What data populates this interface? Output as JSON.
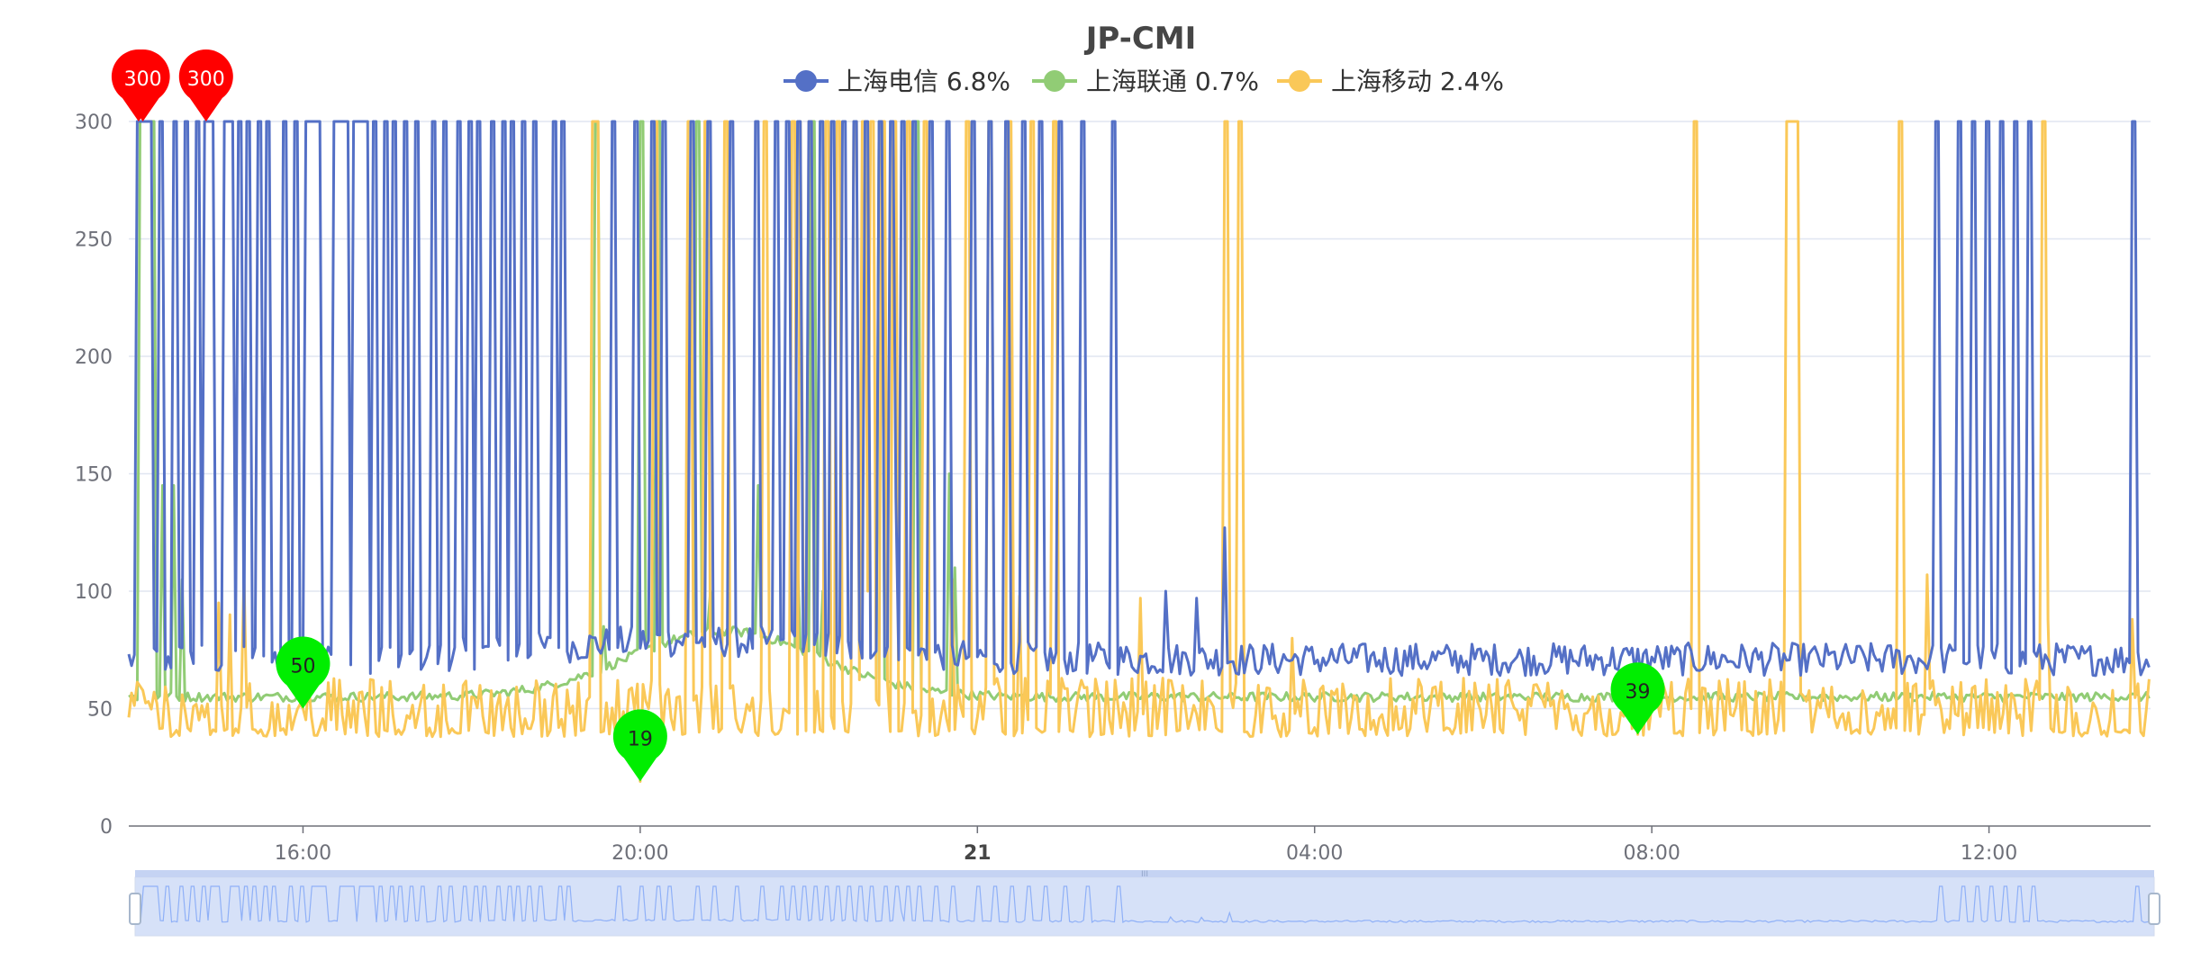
{
  "chart_data": {
    "type": "line",
    "title": "JP-CMI",
    "xlabel": "",
    "ylabel": "",
    "ylim": [
      0,
      300
    ],
    "y_ticks": [
      "0",
      "50",
      "100",
      "150",
      "200",
      "250",
      "300"
    ],
    "x_range": [
      "19 13:56",
      "20 13:55"
    ],
    "x_ticks": [
      {
        "label": "16:00",
        "t": "19 16:00",
        "bold": false
      },
      {
        "label": "20:00",
        "t": "19 20:00",
        "bold": false
      },
      {
        "label": "21",
        "t": "20 00:00",
        "bold": true
      },
      {
        "label": "04:00",
        "t": "20 04:00",
        "bold": false
      },
      {
        "label": "08:00",
        "t": "20 08:00",
        "bold": false
      },
      {
        "label": "12:00",
        "t": "20 12:00",
        "bold": false
      }
    ],
    "grid": true,
    "legend_position": "top-center",
    "series": [
      {
        "name": "上海电信",
        "loss_label": "6.8%",
        "color": "#5470c6",
        "baseline": 68,
        "spikes_value": 300,
        "spike_times": [
          "19 14:10",
          "19 14:18",
          "19 14:28",
          "19 14:36",
          "19 14:44",
          "19 14:55",
          "19 15:05",
          "19 15:09",
          "19 15:14",
          "19 15:20",
          "19 15:29",
          "19 15:35",
          "19 15:47",
          "19 15:54",
          "19 16:02",
          "19 16:06",
          "19 16:10",
          "19 16:22",
          "19 16:27",
          "19 16:31",
          "19 16:36",
          "19 16:40",
          "19 16:45",
          "19 16:50",
          "19 16:59",
          "19 17:05",
          "19 17:12",
          "19 17:20",
          "19 17:33",
          "19 17:41",
          "19 17:50",
          "19 17:58",
          "19 18:05",
          "19 18:14",
          "19 18:22",
          "19 18:29",
          "19 18:37",
          "19 18:45",
          "19 18:58",
          "19 19:05",
          "19 19:40",
          "19 19:56",
          "19 20:08",
          "19 20:17",
          "19 20:37",
          "19 20:48",
          "19 21:04",
          "19 21:23",
          "19 21:36",
          "19 21:44",
          "19 21:52",
          "19 22:00",
          "19 22:08",
          "19 22:17",
          "19 22:25",
          "19 22:33",
          "19 22:41",
          "19 22:50",
          "19 22:58",
          "19 23:06",
          "19 23:14",
          "19 23:26",
          "19 23:39",
          "19 23:56",
          "20 00:08",
          "20 00:20",
          "20 00:33",
          "20 00:45",
          "20 00:58",
          "20 01:14",
          "20 01:36",
          "20 11:23",
          "20 11:38",
          "20 11:49",
          "20 11:59",
          "20 12:09",
          "20 12:19",
          "20 12:28",
          "20 13:43"
        ],
        "extra_points": [
          {
            "t": "19 23:02",
            "v": 140
          },
          {
            "t": "20 02:14",
            "v": 100
          },
          {
            "t": "20 02:37",
            "v": 97
          },
          {
            "t": "20 02:57",
            "v": 127
          }
        ],
        "marks": [
          {
            "type": "max",
            "value": 300,
            "t": "19 14:03",
            "label": "300"
          },
          {
            "type": "max",
            "value": 300,
            "t": "19 14:06",
            "label": "300"
          },
          {
            "type": "max",
            "value": 300,
            "t": "19 14:51",
            "label": "300"
          }
        ]
      },
      {
        "name": "上海联通",
        "loss_label": "0.7%",
        "color": "#91cc75",
        "baseline": 55,
        "spikes_value": 300,
        "spike_times": [
          "19 14:05",
          "19 14:08",
          "19 14:13",
          "19 19:28",
          "19 20:00",
          "19 20:13",
          "19 20:41",
          "19 22:03",
          "19 22:51",
          "19 23:16"
        ],
        "extra_points": [
          {
            "t": "19 14:20",
            "v": 145
          },
          {
            "t": "19 14:28",
            "v": 145
          },
          {
            "t": "19 14:35",
            "v": 105
          },
          {
            "t": "19 19:35",
            "v": 85
          },
          {
            "t": "19 20:50",
            "v": 100
          },
          {
            "t": "19 21:25",
            "v": 145
          },
          {
            "t": "19 21:52",
            "v": 115
          },
          {
            "t": "19 22:10",
            "v": 100
          },
          {
            "t": "19 23:40",
            "v": 150
          },
          {
            "t": "19 23:45",
            "v": 110
          }
        ],
        "marks": []
      },
      {
        "name": "上海移动",
        "loss_label": "2.4%",
        "color": "#fac858",
        "baseline": 40,
        "spikes_value": 300,
        "spike_times": [
          "19 19:26",
          "19 19:29",
          "19 20:11",
          "19 20:34",
          "19 20:47",
          "19 21:01",
          "19 21:29",
          "19 21:48",
          "19 21:54",
          "19 22:01",
          "19 22:12",
          "19 22:20",
          "19 22:32",
          "19 22:39",
          "19 22:44",
          "19 22:53",
          "19 23:00",
          "19 23:10",
          "19 23:22",
          "19 23:53",
          "20 00:09",
          "20 00:22",
          "20 00:39",
          "20 00:54",
          "20 02:57",
          "20 03:06",
          "20 08:30",
          "20 09:36",
          "20 09:40",
          "20 09:43",
          "20 10:56",
          "20 12:39"
        ],
        "extra_points": [
          {
            "t": "19 15:00",
            "v": 95
          },
          {
            "t": "19 15:09",
            "v": 90
          },
          {
            "t": "19 15:18",
            "v": 107
          },
          {
            "t": "19 21:57",
            "v": 105
          },
          {
            "t": "19 22:42",
            "v": 100
          },
          {
            "t": "19 23:43",
            "v": 105
          },
          {
            "t": "20 00:30",
            "v": 98
          },
          {
            "t": "20 01:57",
            "v": 97
          },
          {
            "t": "20 03:45",
            "v": 80
          },
          {
            "t": "20 11:16",
            "v": 107
          },
          {
            "t": "20 12:43",
            "v": 88
          },
          {
            "t": "20 13:42",
            "v": 88
          }
        ],
        "marks": [
          {
            "type": "min",
            "value": 50,
            "t": "19 16:00",
            "label": "50"
          },
          {
            "type": "min",
            "value": 19,
            "t": "19 20:00",
            "label": "19"
          },
          {
            "type": "min",
            "value": 39,
            "t": "20 07:50",
            "label": "39"
          }
        ]
      }
    ],
    "max_mark_color": "#ff0000",
    "min_mark_color": "#00ee00"
  },
  "data_zoom": {
    "start": "19 13:56",
    "end": "20 13:55",
    "handle_label": "III",
    "fill_color": "#d6e1f8",
    "line_color": "#8fb0f7"
  }
}
